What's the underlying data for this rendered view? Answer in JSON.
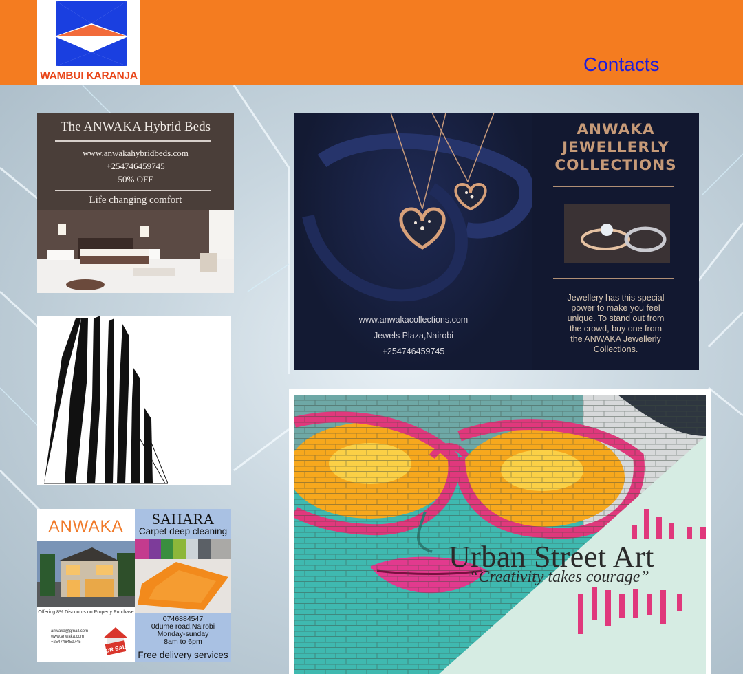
{
  "header": {
    "logo_text": "WAMBUI KARANJA",
    "nav_contacts": "Contacts",
    "background_color": "#f47c20",
    "logo_colors": {
      "blue": "#1a3fe0",
      "orange": "#f26b3a"
    }
  },
  "beds_ad": {
    "title": "The ANWAKA Hybrid Beds",
    "website": "www.anwakahybridbeds.com",
    "phone": "+254746459745",
    "discount": "50% OFF",
    "tagline": "Life changing comfort"
  },
  "jewellery_ad": {
    "title_lines": [
      "ANWAKA",
      "JEWELLERLY",
      "COLLECTIONS"
    ],
    "description_lines": [
      "Jewellery has this special",
      "power to make you feel",
      "unique. To stand out from",
      "the crowd, buy one from",
      "the ANWAKA Jewellerly",
      "Collections."
    ],
    "website": "www.anwakacollections.com",
    "location": "Jewels Plaza,Nairobi",
    "phone": "+254746459745"
  },
  "street_art": {
    "title": "Urban Street Art",
    "quote": "“Creativity takes courage”"
  },
  "property_ad": {
    "brand": "ANWAKA",
    "offer": "Offering 8% Discounts on Property Purchase",
    "email": "anwaka@gmail.com",
    "website": "www.anwaka.com",
    "phone": "+254746459745",
    "sign_text": "FOR SALE"
  },
  "carpet_ad": {
    "title": "SAHARA",
    "subtitle": "Carpet deep cleaning",
    "phone": "0746884547",
    "address": "0dume road,Nairobi",
    "days": "Monday-sunday",
    "hours": "8am to 6pm",
    "footer": "Free delivery services"
  }
}
